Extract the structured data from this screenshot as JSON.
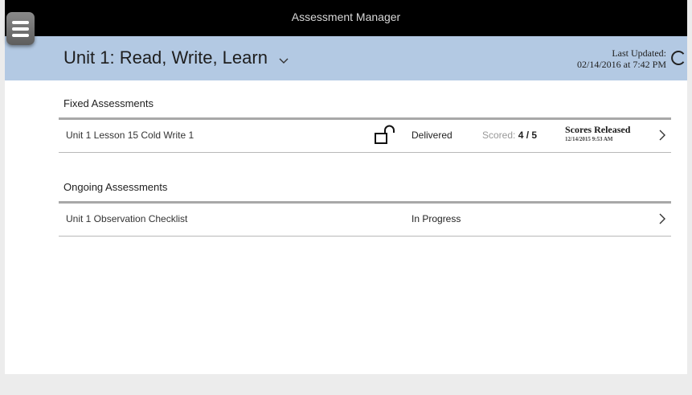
{
  "window": {
    "title": "Assessment Manager"
  },
  "header": {
    "unit_title": "Unit 1: Read, Write, Learn",
    "last_updated_label": "Last Updated:",
    "last_updated_value": "02/14/2016 at 7:42 PM",
    "background_color": "#b3c9e3"
  },
  "fixed": {
    "section_title": "Fixed Assessments",
    "items": [
      {
        "name": "Unit 1 Lesson 15 Cold Write 1",
        "status": "Delivered",
        "scored_label": "Scored:",
        "scored_value": "4 / 5",
        "release_status": "Scores Released",
        "release_date": "12/14/2015 9:53 AM",
        "icon": "unlock-icon"
      }
    ]
  },
  "ongoing": {
    "section_title": "Ongoing Assessments",
    "items": [
      {
        "name": "Unit 1 Observation Checklist",
        "status": "In Progress"
      }
    ]
  },
  "icons": {
    "menu": "hamburger-menu-icon",
    "dropdown": "chevron-down-icon",
    "refresh": "refresh-icon",
    "row_arrow": "chevron-right-icon"
  }
}
